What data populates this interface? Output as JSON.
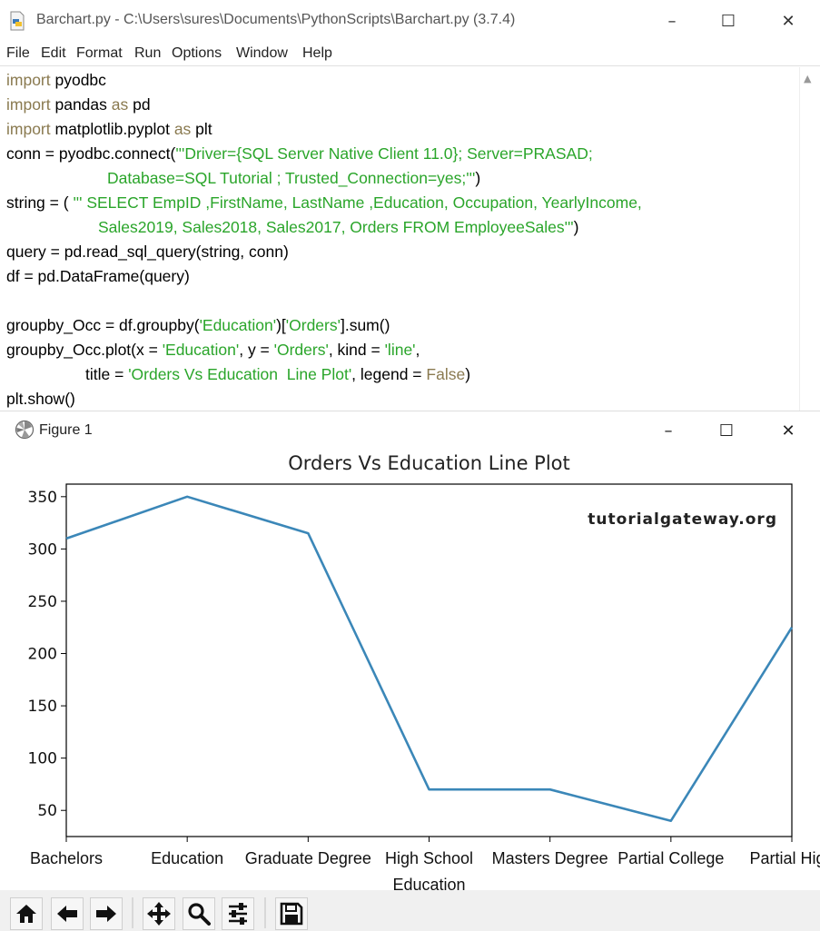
{
  "editor_window": {
    "title": "Barchart.py - C:\\Users\\sures\\Documents\\PythonScripts\\Barchart.py (3.7.4)",
    "menu": [
      "File",
      "Edit",
      "Format",
      "Run",
      "Options",
      "Window",
      "Help"
    ],
    "controls": {
      "minimize": "–",
      "maximize": "☐",
      "close": "✕"
    },
    "code": {
      "l1": {
        "kw": "import",
        "rest": " pyodbc"
      },
      "l2": {
        "kw": "import",
        "mid": " pandas ",
        "kw2": "as",
        "rest": " pd"
      },
      "l3": {
        "kw": "import",
        "mid": " matplotlib.pyplot ",
        "kw2": "as",
        "rest": " plt"
      },
      "l4": {
        "pre": "conn = pyodbc.connect(",
        "str": "'''Driver={SQL Server Native Client 11.0}; Server=PRASAD;"
      },
      "l5": {
        "str": "Database=SQL Tutorial ; Trusted_Connection=yes;'''",
        "post": ")"
      },
      "l6": {
        "pre": "string = ( ",
        "str": "''' SELECT EmpID ,FirstName, LastName ,Education, Occupation, YearlyIncome,"
      },
      "l7": {
        "str": "Sales2019, Sales2018, Sales2017, Orders FROM EmployeeSales'''",
        "post": ")"
      },
      "l8": "query = pd.read_sql_query(string, conn)",
      "l9": "df = pd.DataFrame(query)",
      "l10": {
        "pre": "groupby_Occ = df.groupby(",
        "s1": "'Education'",
        "mid": ")[",
        "s2": "'Orders'",
        "post": "].sum()"
      },
      "l11": {
        "pre": "groupby_Occ.plot(x = ",
        "s1": "'Education'",
        "m1": ", y = ",
        "s2": "'Orders'",
        "m2": ", kind = ",
        "s3": "'line'",
        "post": ","
      },
      "l12": {
        "pre": "title = ",
        "s1": "'Orders Vs Education  Line Plot'",
        "mid": ", legend = ",
        "kw": "False",
        "post": ")"
      },
      "l13": "plt.show()"
    }
  },
  "figure_window": {
    "title": "Figure 1",
    "controls": {
      "minimize": "–",
      "maximize": "☐",
      "close": "✕"
    },
    "toolbar": [
      "home-icon",
      "back-arrow-icon",
      "forward-arrow-icon",
      "pan-icon",
      "zoom-icon",
      "configure-subplots-icon",
      "save-icon"
    ]
  },
  "chart_data": {
    "type": "line",
    "title": "Orders Vs Education  Line Plot",
    "xlabel": "Education",
    "ylabel": "",
    "categories": [
      "Bachelors",
      "Education",
      "Graduate Degree",
      "High School",
      "Masters Degree",
      "Partial College",
      "Partial High"
    ],
    "values": [
      310,
      350,
      315,
      70,
      70,
      40,
      225
    ],
    "yticks": [
      50,
      100,
      150,
      200,
      250,
      300,
      350
    ],
    "ylim": [
      25,
      362
    ],
    "line_color": "#3b87b8",
    "grid": false,
    "legend": false,
    "watermark": "tutorialgateway.org"
  }
}
